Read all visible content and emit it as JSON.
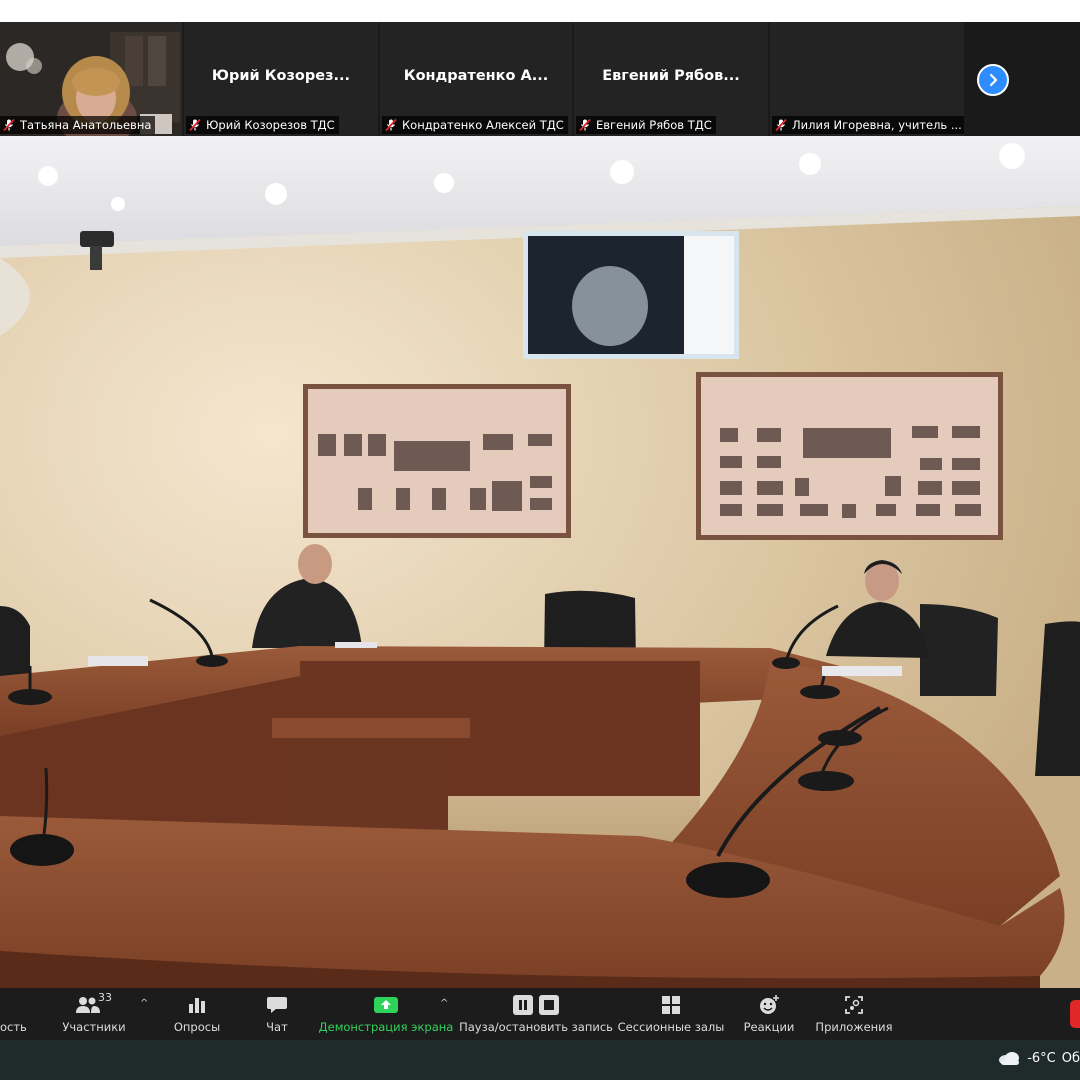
{
  "participants_strip": {
    "tiles": [
      {
        "caption": "Татьяна Анатольевна"
      },
      {
        "display_name": "Юрий  Козорез...",
        "caption": "Юрий Козорезов ТДС"
      },
      {
        "display_name": "Кондратенко  А...",
        "caption": "Кондратенко Алексей ТДС"
      },
      {
        "display_name": "Евгений  Рябов...",
        "caption": "Евгений Рябов ТДС"
      },
      {
        "caption": "Лилия Игоревна, учитель ..."
      }
    ],
    "next_page_icon": "chevron-right-icon"
  },
  "toolbar": {
    "security_partial": "ость",
    "participants_label": "Участники",
    "participants_count": "33",
    "polls_label": "Опросы",
    "chat_label": "Чат",
    "share_label": "Демонстрация экрана",
    "recording_label": "Пауза/остановить запись",
    "breakout_label": "Сессионные залы",
    "reactions_label": "Реакции",
    "apps_label": "Приложения",
    "colors": {
      "share": "#2fd35a",
      "end": "#e02828",
      "next": "#2d8cff"
    }
  },
  "taskbar": {
    "temperature": "-6°C",
    "weather_text_partial": "Об",
    "weather_icon": "cloud-icon"
  }
}
